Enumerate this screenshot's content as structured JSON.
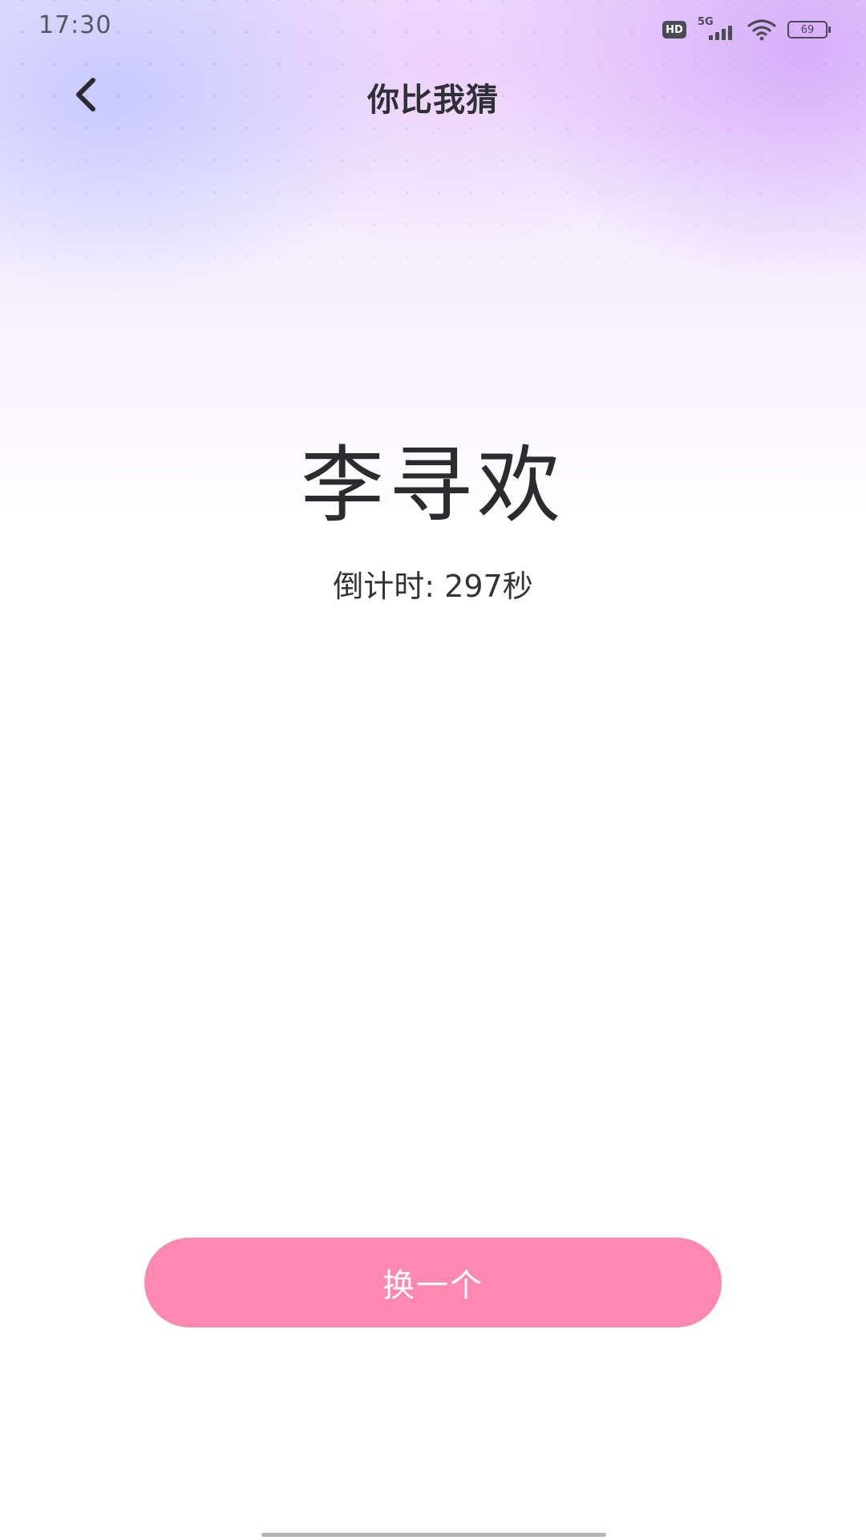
{
  "status_bar": {
    "time": "17:30",
    "hd_label": "HD",
    "network_label": "5G",
    "battery_level": "69",
    "icons": [
      "hd-icon",
      "signal-icon",
      "wifi-icon",
      "battery-icon"
    ]
  },
  "header": {
    "title": "你比我猜",
    "back_icon": "chevron-left-icon"
  },
  "game": {
    "word": "李寻欢",
    "countdown": "倒计时: 297秒"
  },
  "actions": {
    "change_label": "换一个"
  },
  "colors": {
    "button": "#ff88b3",
    "title_text": "#2f2f36",
    "body_text": "#2b2b30"
  }
}
